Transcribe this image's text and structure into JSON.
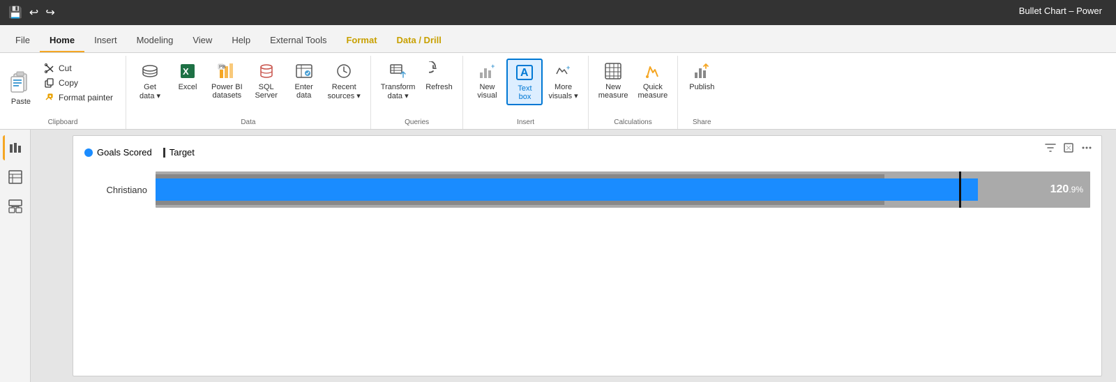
{
  "titlebar": {
    "title": "Bullet Chart – Power",
    "save_icon": "💾",
    "undo_icon": "↩",
    "redo_icon": "↪"
  },
  "tabs": [
    {
      "id": "file",
      "label": "File",
      "active": false
    },
    {
      "id": "home",
      "label": "Home",
      "active": true
    },
    {
      "id": "insert",
      "label": "Insert",
      "active": false
    },
    {
      "id": "modeling",
      "label": "Modeling",
      "active": false
    },
    {
      "id": "view",
      "label": "View",
      "active": false
    },
    {
      "id": "help",
      "label": "Help",
      "active": false
    },
    {
      "id": "external-tools",
      "label": "External Tools",
      "active": false
    },
    {
      "id": "format",
      "label": "Format",
      "active": false,
      "highlight": true
    },
    {
      "id": "data-drill",
      "label": "Data / Drill",
      "active": false,
      "highlight": true
    }
  ],
  "ribbon": {
    "groups": [
      {
        "id": "clipboard",
        "label": "Clipboard",
        "items": [
          {
            "id": "paste",
            "label": "Paste",
            "large": true
          },
          {
            "id": "cut",
            "label": "Cut"
          },
          {
            "id": "copy",
            "label": "Copy"
          },
          {
            "id": "format-painter",
            "label": "Format painter"
          }
        ]
      },
      {
        "id": "data",
        "label": "Data",
        "items": [
          {
            "id": "get-data",
            "label": "Get\ndata ▾",
            "large": true
          },
          {
            "id": "excel",
            "label": "Excel",
            "large": true
          },
          {
            "id": "power-bi-datasets",
            "label": "Power BI\ndatasets",
            "large": true
          },
          {
            "id": "sql-server",
            "label": "SQL\nServer",
            "large": true
          },
          {
            "id": "enter-data",
            "label": "Enter\ndata",
            "large": true
          },
          {
            "id": "recent-sources",
            "label": "Recent\nsources ▾",
            "large": true
          }
        ]
      },
      {
        "id": "queries",
        "label": "Queries",
        "items": [
          {
            "id": "transform-data",
            "label": "Transform\ndata ▾",
            "large": true
          },
          {
            "id": "refresh",
            "label": "Refresh",
            "large": true
          }
        ]
      },
      {
        "id": "insert",
        "label": "Insert",
        "items": [
          {
            "id": "new-visual",
            "label": "New\nvisual",
            "large": true
          },
          {
            "id": "text-box",
            "label": "Text\nbox",
            "large": true,
            "active": true
          },
          {
            "id": "more-visuals",
            "label": "More\nvisuals ▾",
            "large": true
          }
        ]
      },
      {
        "id": "calculations",
        "label": "Calculations",
        "items": [
          {
            "id": "new-measure",
            "label": "New\nmeasure",
            "large": true
          },
          {
            "id": "quick-measure",
            "label": "Quick\nmeasure",
            "large": true
          }
        ]
      },
      {
        "id": "share",
        "label": "Share",
        "items": [
          {
            "id": "publish",
            "label": "Publish",
            "large": true
          }
        ]
      }
    ]
  },
  "sidebar": {
    "items": [
      {
        "id": "report",
        "label": "📊",
        "active": true
      },
      {
        "id": "data",
        "label": "⊞",
        "active": false
      },
      {
        "id": "model",
        "label": "⊟",
        "active": false
      }
    ]
  },
  "chart": {
    "title": "",
    "legend": [
      {
        "type": "dot",
        "color": "#1a8cff",
        "label": "Goals Scored"
      },
      {
        "type": "line",
        "color": "#333",
        "label": "Target"
      }
    ],
    "rows": [
      {
        "label": "Christiano",
        "value": "120",
        "suffix": ".9%",
        "barWidth": "88%"
      }
    ]
  }
}
